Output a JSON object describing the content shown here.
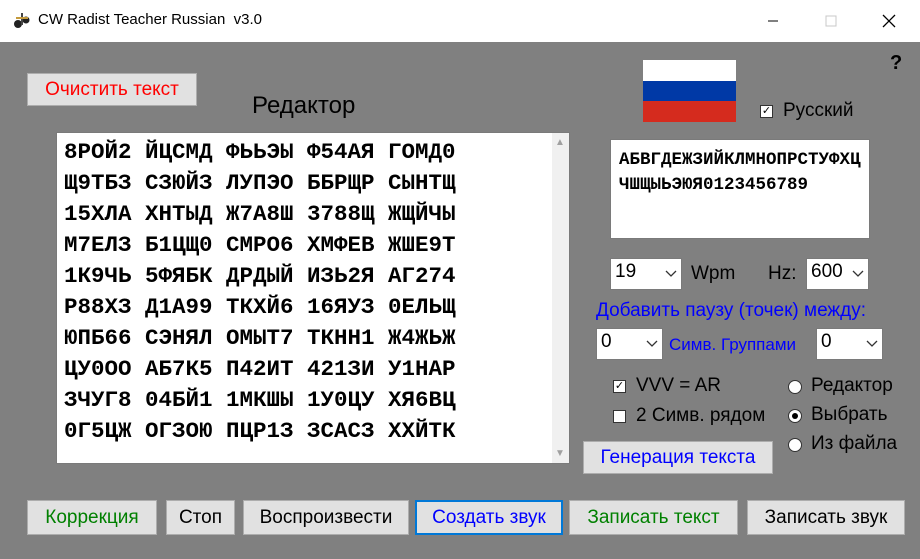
{
  "window": {
    "title": "CW Radist Teacher Russian  v3.0",
    "help": "?"
  },
  "buttons": {
    "clear": "Очистить текст",
    "generate": "Генерация текста",
    "correction": "Коррекция",
    "stop": "Стоп",
    "play": "Воспроизвести",
    "create_sound": "Создать звук",
    "write_text": "Записать текст",
    "write_sound": "Записать звук"
  },
  "editor": {
    "title": "Редактор",
    "lines": [
      "8РОЙ2 ЙЦСМД ФЬЬЭЫ Ф54АЯ ГОМД0",
      "Щ9ТБЗ СЗЮЙЗ ЛУПЭО ББРЩР СЫНТЩ",
      "15ХЛА ХНТЫД Ж7А8Ш 3788Щ ЖЩЙЧЫ",
      "М7ЕЛЗ Б1ЦЩ0 СМРО6 ХМФЕВ ЖШЕ9Т",
      "1К9ЧЬ 5ФЯБК ДРДЫЙ ИЗЬ2Я АГ274",
      "Р88ХЗ Д1А99 ТКХЙ6 16ЯУЗ 0ЕЛЬЩ",
      "ЮПБ66 СЭНЯЛ ОМЫТ7 ТКНН1 Ж4ЖЬЖ",
      "ЦУ0ОО АБ7К5 П42ИТ 421ЗИ У1НАР",
      "ЗЧУГ8 04БЙ1 1МКШЫ 1У0ЦУ ХЯ6ВЦ",
      "0Г5ЦЖ ОГЗОЮ ПЦР1З ЗСАСЗ ХХЙТК"
    ]
  },
  "language": {
    "label": "Русский",
    "checked": true
  },
  "alphabet": "АБВГДЕЖЗИЙКЛМНОПРСТУФХЦЧШЩЫЬЭЮЯ0123456789",
  "settings": {
    "wpm_value": "19",
    "wpm_label": "Wpm",
    "hz_label": "Hz:",
    "hz_value": "600",
    "pause_heading": "Добавить паузу (точек) между:",
    "symbols_value": "0",
    "pause_mid_label": "Симв. Группами",
    "groups_value": "0"
  },
  "options": {
    "vvv_label": "VVV = AR",
    "vvv_checked": true,
    "two_symbols_label": "2 Симв. рядом",
    "two_symbols_checked": false
  },
  "source": {
    "editor": "Редактор",
    "select": "Выбрать",
    "file": "Из файла",
    "selected": "Выбрать"
  },
  "colors": {
    "background": "#808080",
    "red_text": "#ff0000",
    "green_text": "#008000",
    "blue_text": "#0000ff",
    "accent_border": "#0078d7",
    "flag_white": "#ffffff",
    "flag_blue": "#0039a6",
    "flag_red": "#d52b1e"
  }
}
